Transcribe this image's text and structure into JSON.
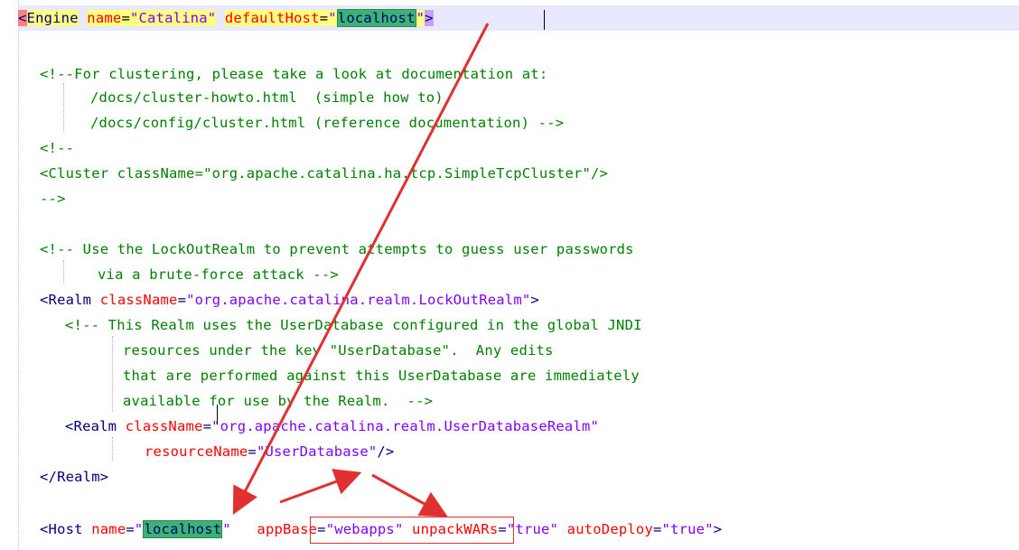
{
  "lines": {
    "l1": {
      "bracket": "<",
      "tag": "Engine",
      "a1": "name",
      "v1": "\"Catalina\"",
      "a2": "defaultHost",
      "v2a": "\"",
      "v2b": "localhost",
      "v2c": "\"",
      "close": ">"
    },
    "l2": "<!--For clustering, please take a look at documentation at:",
    "l3": "/docs/cluster-howto.html  (simple how to)",
    "l4": "/docs/config/cluster.html (reference documentation) -->",
    "l5": "<!--",
    "l6": "<Cluster className=\"org.apache.catalina.ha.tcp.SimpleTcpCluster\"/>",
    "l7": "-->",
    "l8": "<!-- Use the LockOutRealm to prevent attempts to guess user passwords",
    "l9": "via a brute-force attack -->",
    "l10": {
      "open": "<",
      "tag": "Realm",
      "attr": "className",
      "eq": "=",
      "val": "\"org.apache.catalina.realm.LockOutRealm\"",
      "close": ">"
    },
    "l11": "<!-- This Realm uses the UserDatabase configured in the global JNDI",
    "l12": "resources under the key \"UserDatabase\".  Any edits",
    "l13": "that are performed against this UserDatabase are immediately",
    "l14": "available for use by the Realm.  -->",
    "l15": {
      "open": "<",
      "tag": "Realm",
      "attr": "className",
      "eq": "=",
      "val": "\"org.apache.catalina.realm.UserDatabaseRealm\""
    },
    "l16": {
      "attr": "resourceName",
      "eq": "=",
      "val": "\"UserDatabase\"",
      "close": "/>"
    },
    "l17": "</Realm>",
    "l18": {
      "open": "<",
      "tag": "Host",
      "a1": "name",
      "v1a": "\"",
      "v1b": "localhost",
      "v1c": "\"",
      "a2": "appBase",
      "v2": "\"webapps\"",
      "a3": "unpackWARs",
      "v3": "\"true\"",
      "a4": "autoDeploy",
      "v4": "\"true\"",
      "close": ">"
    }
  },
  "annotation_color": "#e03030"
}
